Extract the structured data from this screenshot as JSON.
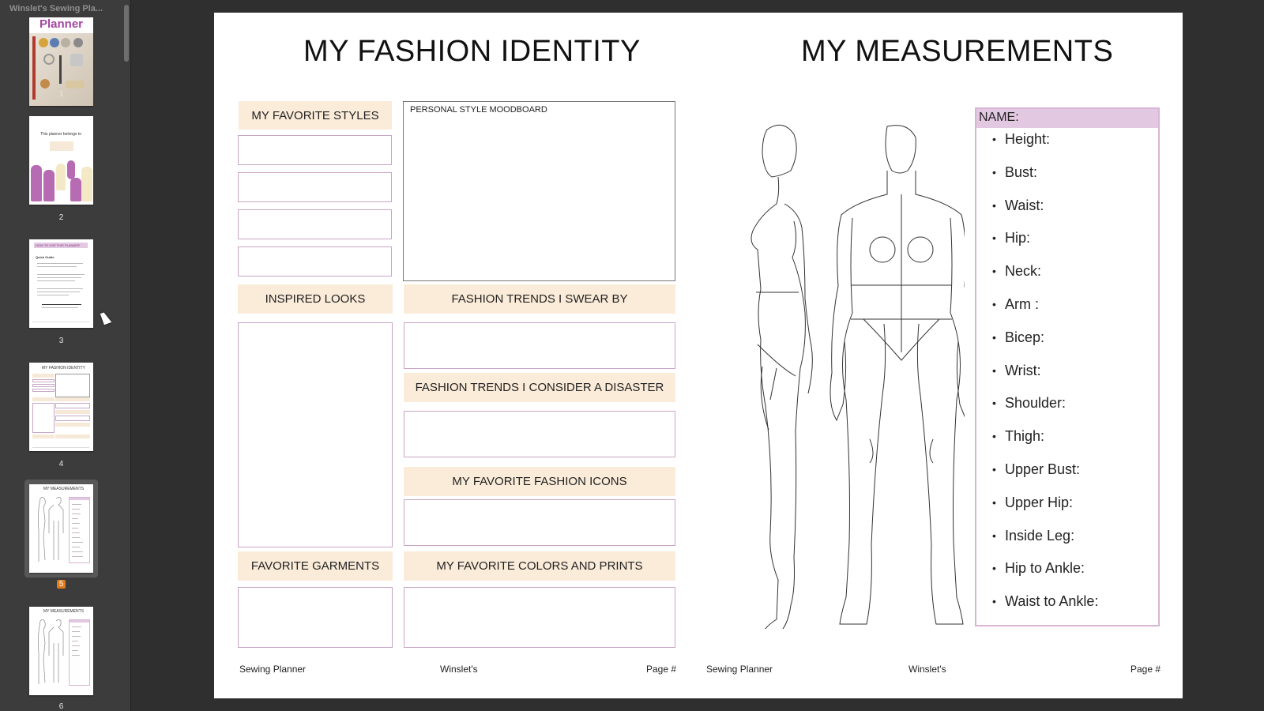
{
  "sidebar": {
    "title": "Winslet's Sewing Pla...",
    "thumbnails": [
      {
        "number": "1",
        "caption": "Planner"
      },
      {
        "number": "2",
        "caption": "This planner belongs to"
      },
      {
        "number": "3",
        "caption": "HOW TO USE THIS PLANNER"
      },
      {
        "number": "4",
        "caption": "MY FASHION IDENTITY"
      },
      {
        "number": "5",
        "caption": "MY MEASUREMENTS"
      },
      {
        "number": "6",
        "caption": "MY MEASUREMENTS"
      }
    ],
    "selected_page": "5"
  },
  "page": {
    "left": {
      "title": "MY FASHION IDENTITY",
      "favorite_styles": "MY FAVORITE STYLES",
      "moodboard": "PERSONAL STYLE MOODBOARD",
      "inspired_looks": "INSPIRED LOOKS",
      "trends_swear": "FASHION TRENDS I SWEAR BY",
      "trends_disaster": "FASHION TRENDS I CONSIDER A DISASTER",
      "fashion_icons": "MY FAVORITE FASHION ICONS",
      "favorite_garments": "FAVORITE GARMENTS",
      "colors_prints": "MY FAVORITE COLORS AND PRINTS",
      "footer": {
        "left": "Sewing Planner",
        "center": "Winslet's",
        "right": "Page #"
      }
    },
    "right": {
      "title": "MY MEASUREMENTS",
      "name_label": "NAME:",
      "measurements": [
        "Height:",
        "Bust:",
        "Waist:",
        "Hip:",
        "Neck:",
        "Arm :",
        "Bicep:",
        "Wrist:",
        "Shoulder:",
        "Thigh:",
        "Upper Bust:",
        "Upper Hip:",
        "Inside Leg:",
        "Hip to Ankle:",
        "Waist to Ankle:"
      ],
      "footer": {
        "left": "Sewing Planner",
        "center": "Winslet's",
        "right": "Page #"
      }
    }
  },
  "colors": {
    "label_bg": "#fbecd9",
    "box_border": "#c8a5c6",
    "name_bar": "#e3c8e2",
    "badge": "#e07a1b"
  }
}
